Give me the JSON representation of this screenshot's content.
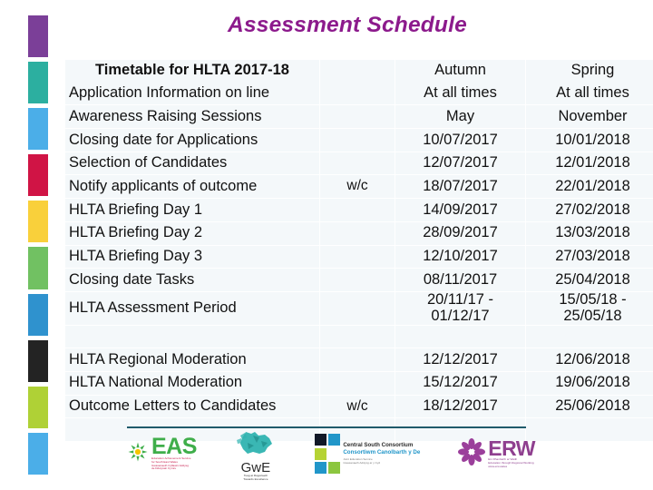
{
  "title": "Assessment Schedule",
  "title_color": "#8C1A8C",
  "color_strip": {
    "name": "left-color-strip",
    "swatches": [
      {
        "name": "swatch-purple",
        "color": "#7B3F98"
      },
      {
        "name": "swatch-teal",
        "color": "#2CAFA0"
      },
      {
        "name": "swatch-blue",
        "color": "#4BAEE8"
      },
      {
        "name": "swatch-crimson",
        "color": "#D01445"
      },
      {
        "name": "swatch-yellow",
        "color": "#F9D03B"
      },
      {
        "name": "swatch-green",
        "color": "#71C162"
      },
      {
        "name": "swatch-steel-blue",
        "color": "#2F92CE"
      },
      {
        "name": "swatch-black",
        "color": "#232323"
      },
      {
        "name": "swatch-lime",
        "color": "#AFD136"
      },
      {
        "name": "swatch-sky",
        "color": "#4BAEE8"
      }
    ]
  },
  "table": {
    "headers": {
      "task": "Timetable for HLTA 2017-18",
      "wc": "",
      "autumn": "Autumn",
      "spring": "Spring"
    },
    "rows": [
      {
        "task": "Application Information on line",
        "wc": "",
        "autumn": "At all times",
        "spring": "At all times"
      },
      {
        "task": "Awareness Raising Sessions",
        "wc": "",
        "autumn": "May",
        "spring": "November"
      },
      {
        "task": "Closing date for Applications",
        "wc": "",
        "autumn": "10/07/2017",
        "spring": "10/01/2018"
      },
      {
        "task": "Selection of Candidates",
        "wc": "",
        "autumn": "12/07/2017",
        "spring": "12/01/2018"
      },
      {
        "task": "Notify applicants of outcome",
        "wc": "w/c",
        "autumn": "18/07/2017",
        "spring": "22/01/2018"
      },
      {
        "task": "HLTA Briefing Day 1",
        "wc": "",
        "autumn": "14/09/2017",
        "spring": "27/02/2018"
      },
      {
        "task": "HLTA Briefing Day 2",
        "wc": "",
        "autumn": "28/09/2017",
        "spring": "13/03/2018"
      },
      {
        "task": "HLTA Briefing Day 3",
        "wc": "",
        "autumn": "12/10/2017",
        "spring": "27/03/2018"
      },
      {
        "task": "Closing date Tasks",
        "wc": "",
        "autumn": "08/11/2017",
        "spring": "25/04/2018"
      },
      {
        "task": "HLTA Assessment Period",
        "wc": "",
        "autumn": "20/11/17 -\n01/12/17",
        "spring": "15/05/18 -\n25/05/18",
        "tall": true
      },
      {
        "task": "",
        "wc": "",
        "autumn": "",
        "spring": "",
        "spacer": true
      },
      {
        "task": "HLTA Regional Moderation",
        "wc": "",
        "autumn": "12/12/2017",
        "spring": "12/06/2018"
      },
      {
        "task": "HLTA National Moderation",
        "wc": "",
        "autumn": "15/12/2017",
        "spring": "19/06/2018"
      },
      {
        "task": "Outcome Letters to Candidates",
        "wc": "w/c",
        "autumn": "18/12/2017",
        "spring": "25/06/2018"
      },
      {
        "task": "",
        "wc": "",
        "autumn": "",
        "spring": "",
        "spacer": true
      }
    ]
  },
  "logos": [
    {
      "name": "eas-logo",
      "word": "EAS",
      "sub": [
        "Education Achievement Service",
        "for South East Wales",
        "Gwasanaeth Cyflawni Addysg",
        "de Ddwyrain Cymru"
      ]
    },
    {
      "name": "gwe-logo",
      "word": "GwE",
      "sub": [
        "Tuag at Ragoriaeth",
        "Towards Excellence"
      ]
    },
    {
      "name": "central-south-consortium-logo",
      "name_en": "Central South Consortium",
      "name_cy": "Consortiwm Canolbarth y De",
      "sub": [
        "Joint Education Service",
        "Gwasanaeth Addysg ar y Cyd"
      ]
    },
    {
      "name": "erw-logo",
      "word": "ERW",
      "sub": [
        "Ein Rhanbarth ar Waith",
        "Education through Regional Working",
        "",
        "www.erw.wales"
      ]
    }
  ],
  "divider_color": "#1f5a6b"
}
